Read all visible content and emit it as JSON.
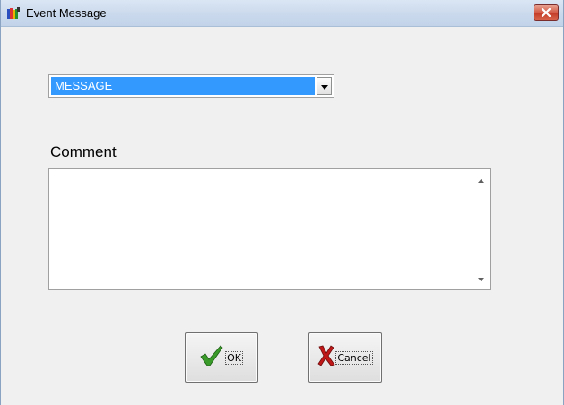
{
  "window": {
    "title": "Event Message"
  },
  "message_combo": {
    "selected": "MESSAGE"
  },
  "comment": {
    "label": "Comment",
    "value": ""
  },
  "buttons": {
    "ok_label": "OK",
    "cancel_label": "Cancel"
  },
  "icons": {
    "title": "app-icon",
    "close": "close-icon",
    "dropdown": "chevron-down-icon",
    "ok": "checkmark-icon",
    "cancel": "x-cancel-icon"
  },
  "colors": {
    "selection": "#3399ff",
    "ok_check": "#3a9b2a",
    "cancel_x": "#c01818",
    "close_button": "#c23a25"
  }
}
